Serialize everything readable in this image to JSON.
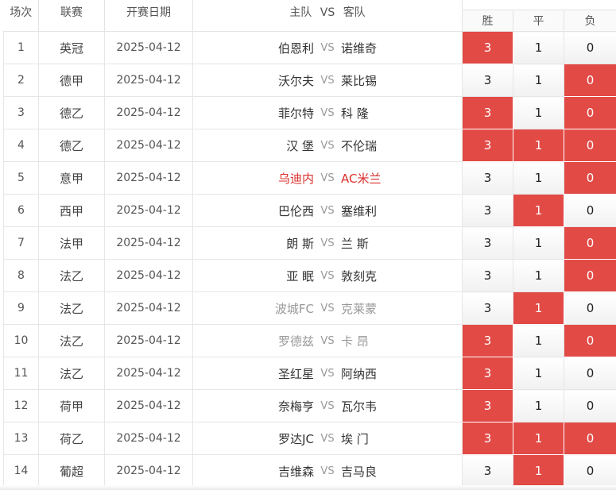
{
  "headers": {
    "idx": "场次",
    "league": "联赛",
    "date": "开赛日期",
    "home": "主队",
    "vs": "VS",
    "away": "客队",
    "win": "胜",
    "draw": "平",
    "lose": "负"
  },
  "colors": {
    "selected_bg": "#e24a46",
    "highlight_team": "#d9302c",
    "muted_team": "#999999"
  },
  "rows": [
    {
      "idx": "1",
      "league": "英冠",
      "date": "2025-04-12",
      "home": "伯恩利",
      "vs": "VS",
      "away": "诺维奇",
      "team_style": "normal",
      "odds": [
        {
          "v": "3",
          "on": true
        },
        {
          "v": "1",
          "on": false
        },
        {
          "v": "0",
          "on": false
        }
      ]
    },
    {
      "idx": "2",
      "league": "德甲",
      "date": "2025-04-12",
      "home": "沃尔夫",
      "vs": "VS",
      "away": "莱比锡",
      "team_style": "normal",
      "odds": [
        {
          "v": "3",
          "on": false
        },
        {
          "v": "1",
          "on": false
        },
        {
          "v": "0",
          "on": true
        }
      ]
    },
    {
      "idx": "3",
      "league": "德乙",
      "date": "2025-04-12",
      "home": "菲尔特",
      "vs": "VS",
      "away": "科 隆",
      "team_style": "normal",
      "odds": [
        {
          "v": "3",
          "on": true
        },
        {
          "v": "1",
          "on": false
        },
        {
          "v": "0",
          "on": true
        }
      ]
    },
    {
      "idx": "4",
      "league": "德乙",
      "date": "2025-04-12",
      "home": "汉 堡",
      "vs": "VS",
      "away": "不伦瑞",
      "team_style": "normal",
      "odds": [
        {
          "v": "3",
          "on": true
        },
        {
          "v": "1",
          "on": true
        },
        {
          "v": "0",
          "on": true
        }
      ]
    },
    {
      "idx": "5",
      "league": "意甲",
      "date": "2025-04-12",
      "home": "乌迪内",
      "vs": "VS",
      "away": "AC米兰",
      "team_style": "red",
      "odds": [
        {
          "v": "3",
          "on": false
        },
        {
          "v": "1",
          "on": false
        },
        {
          "v": "0",
          "on": true
        }
      ]
    },
    {
      "idx": "6",
      "league": "西甲",
      "date": "2025-04-12",
      "home": "巴伦西",
      "vs": "VS",
      "away": "塞维利",
      "team_style": "normal",
      "odds": [
        {
          "v": "3",
          "on": false
        },
        {
          "v": "1",
          "on": true
        },
        {
          "v": "0",
          "on": false
        }
      ]
    },
    {
      "idx": "7",
      "league": "法甲",
      "date": "2025-04-12",
      "home": "朗 斯",
      "vs": "VS",
      "away": "兰 斯",
      "team_style": "normal",
      "odds": [
        {
          "v": "3",
          "on": false
        },
        {
          "v": "1",
          "on": false
        },
        {
          "v": "0",
          "on": true
        }
      ]
    },
    {
      "idx": "8",
      "league": "法乙",
      "date": "2025-04-12",
      "home": "亚 眠",
      "vs": "VS",
      "away": "敦刻克",
      "team_style": "normal",
      "odds": [
        {
          "v": "3",
          "on": false
        },
        {
          "v": "1",
          "on": false
        },
        {
          "v": "0",
          "on": true
        }
      ]
    },
    {
      "idx": "9",
      "league": "法乙",
      "date": "2025-04-12",
      "home": "波城FC",
      "vs": "VS",
      "away": "克莱蒙",
      "team_style": "gray",
      "odds": [
        {
          "v": "3",
          "on": false
        },
        {
          "v": "1",
          "on": true
        },
        {
          "v": "0",
          "on": false
        }
      ]
    },
    {
      "idx": "10",
      "league": "法乙",
      "date": "2025-04-12",
      "home": "罗德兹",
      "vs": "VS",
      "away": "卡 昂",
      "team_style": "gray",
      "odds": [
        {
          "v": "3",
          "on": true
        },
        {
          "v": "1",
          "on": false
        },
        {
          "v": "0",
          "on": true
        }
      ]
    },
    {
      "idx": "11",
      "league": "法乙",
      "date": "2025-04-12",
      "home": "圣红星",
      "vs": "VS",
      "away": "阿纳西",
      "team_style": "normal",
      "odds": [
        {
          "v": "3",
          "on": true
        },
        {
          "v": "1",
          "on": false
        },
        {
          "v": "0",
          "on": false
        }
      ]
    },
    {
      "idx": "12",
      "league": "荷甲",
      "date": "2025-04-12",
      "home": "奈梅亨",
      "vs": "VS",
      "away": "瓦尔韦",
      "team_style": "normal",
      "odds": [
        {
          "v": "3",
          "on": true
        },
        {
          "v": "1",
          "on": false
        },
        {
          "v": "0",
          "on": false
        }
      ]
    },
    {
      "idx": "13",
      "league": "荷乙",
      "date": "2025-04-12",
      "home": "罗达JC",
      "vs": "VS",
      "away": "埃 门",
      "team_style": "normal",
      "odds": [
        {
          "v": "3",
          "on": true
        },
        {
          "v": "1",
          "on": true
        },
        {
          "v": "0",
          "on": true
        }
      ]
    },
    {
      "idx": "14",
      "league": "葡超",
      "date": "2025-04-12",
      "home": "吉维森",
      "vs": "VS",
      "away": "吉马良",
      "team_style": "normal",
      "odds": [
        {
          "v": "3",
          "on": false
        },
        {
          "v": "1",
          "on": true
        },
        {
          "v": "0",
          "on": false
        }
      ]
    }
  ]
}
